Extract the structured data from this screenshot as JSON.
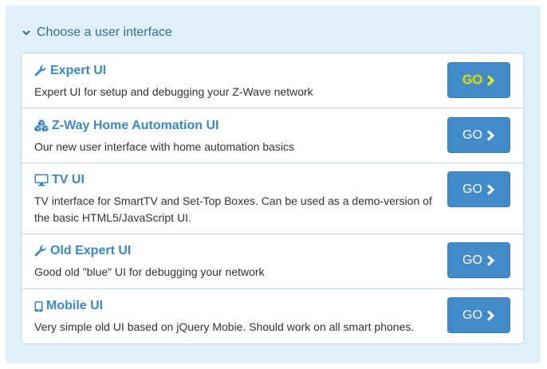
{
  "panel": {
    "header": "Choose a user interface",
    "icon": "chevron-down-icon"
  },
  "items": [
    {
      "title": "Expert UI",
      "icon": "wrench-icon",
      "description": "Expert UI for setup and debugging your Z-Wave network",
      "button": "GO",
      "button_icon": "chevron-right-icon",
      "highlighted": true
    },
    {
      "title": "Z-Way Home Automation UI",
      "icon": "cubes-icon",
      "description": "Our new user interface with home automation basics",
      "button": "GO",
      "button_icon": "chevron-right-icon"
    },
    {
      "title": "TV UI",
      "icon": "monitor-icon",
      "description": "TV interface for SmartTV and Set-Top Boxes. Can be used as a demo-version of the basic HTML5/JavaScript UI.",
      "button": "GO",
      "button_icon": "chevron-right-icon"
    },
    {
      "title": "Old Expert UI",
      "icon": "wrench-icon",
      "description": "Good old \"blue\" UI for debugging your network",
      "button": "GO",
      "button_icon": "chevron-right-icon"
    },
    {
      "title": "Mobile UI",
      "icon": "mobile-phone-icon",
      "description": "Very simple old UI based on jQuery Mobie. Should work on all smart phones.",
      "button": "GO",
      "button_icon": "chevron-right-icon"
    }
  ],
  "colors": {
    "panel_bg": "#dff0f8",
    "header_text": "#31708f",
    "title_link": "#3a87c8",
    "button_bg": "#428bca",
    "highlight_text": "#f2f200"
  }
}
